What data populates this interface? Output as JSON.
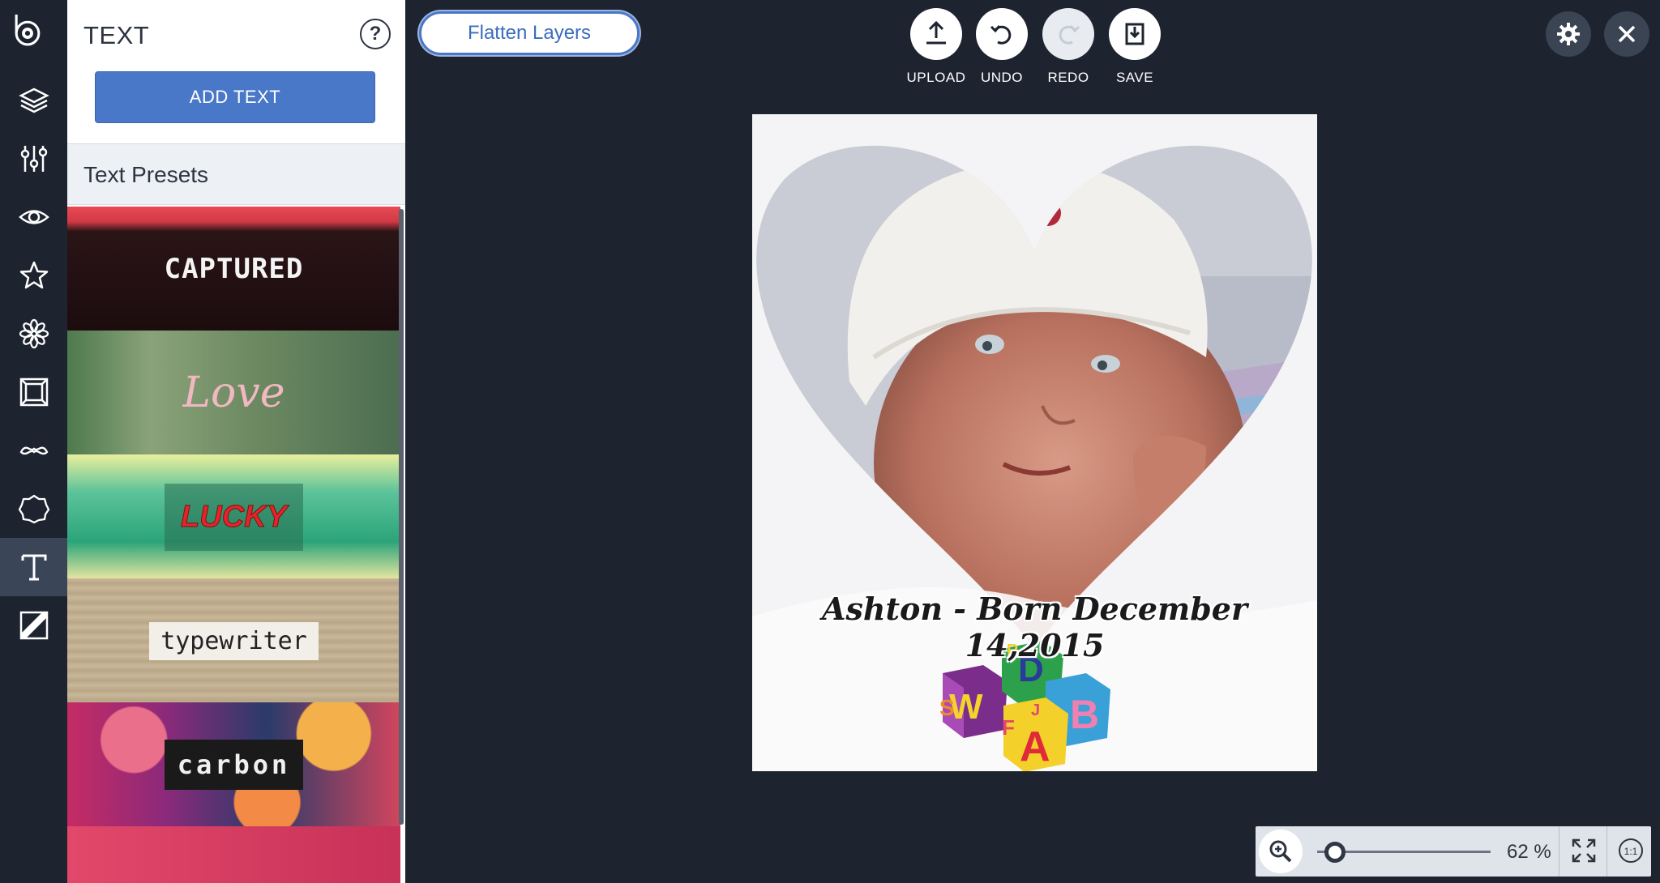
{
  "rail": {
    "logo_icon": "befunky-logo-icon",
    "items": [
      {
        "name": "layers",
        "icon": "layers-icon"
      },
      {
        "name": "adjust",
        "icon": "sliders-icon"
      },
      {
        "name": "view",
        "icon": "eye-icon"
      },
      {
        "name": "favorites",
        "icon": "star-icon"
      },
      {
        "name": "effects",
        "icon": "flower-icon"
      },
      {
        "name": "frames",
        "icon": "frame-icon"
      },
      {
        "name": "touch-up",
        "icon": "mustache-icon"
      },
      {
        "name": "graphics",
        "icon": "badge-icon"
      },
      {
        "name": "text",
        "icon": "text-icon",
        "active": true
      },
      {
        "name": "textures",
        "icon": "texture-icon"
      }
    ]
  },
  "panel": {
    "title": "TEXT",
    "help_label": "?",
    "add_text_label": "ADD TEXT",
    "presets_heading": "Text Presets",
    "presets": [
      {
        "label": "CAPTURED"
      },
      {
        "label": "Love"
      },
      {
        "label": "LUCKY"
      },
      {
        "label": "typewriter"
      },
      {
        "label": "carbon"
      },
      {
        "label": ""
      }
    ]
  },
  "toolbar": {
    "flatten_label": "Flatten Layers",
    "upload_label": "UPLOAD",
    "undo_label": "UNDO",
    "redo_label": "REDO",
    "save_label": "SAVE"
  },
  "canvas": {
    "caption": "Ashton - Born December 14,2015",
    "blocks_letters": [
      "S",
      "W",
      "D",
      "B",
      "A",
      "F",
      "J",
      "R"
    ]
  },
  "zoom": {
    "value_label": "62 %",
    "level_percent": 62
  },
  "colors": {
    "background": "#1d2430",
    "accent": "#4a78c8",
    "panel": "#ffffff"
  }
}
